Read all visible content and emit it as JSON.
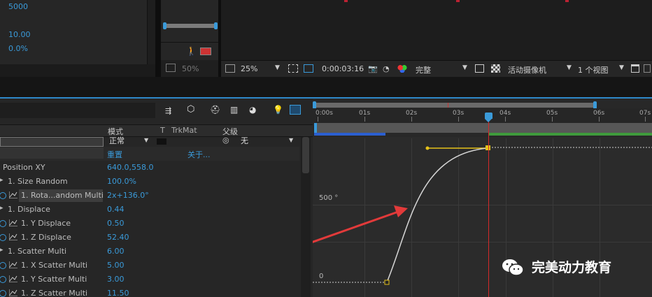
{
  "info_panel": {
    "value_5000": "5000",
    "value_10": "10.00",
    "value_0pct": "0.0%"
  },
  "mini_panel": {
    "zoom": "50%"
  },
  "comp_toolbar": {
    "zoom": "25%",
    "timecode": "0:00:03:16",
    "resolution": "完整",
    "camera": "活动摄像机",
    "views": "1 个视图"
  },
  "layer_columns": {
    "mode": "模式",
    "t": "T",
    "trkmat": "TrkMat",
    "parent": "父级"
  },
  "layer_row": {
    "mode_value": "正常",
    "parent_value": "无",
    "reset": "重置",
    "about": "关于..."
  },
  "properties": [
    {
      "label": "Position XY",
      "value": "640.0,558.0"
    },
    {
      "label": "1. Size Random",
      "value": "100.0%"
    },
    {
      "label": "1. Rota...andom Multi",
      "value": "2x+136.0°"
    },
    {
      "label": "1. Displace",
      "value": "0.44"
    },
    {
      "label": "1. Y Displace",
      "value": "0.50"
    },
    {
      "label": "1. Z Displace",
      "value": "52.40"
    },
    {
      "label": "1. Scatter Multi",
      "value": "6.00"
    },
    {
      "label": "1. X Scatter Multi",
      "value": "5.00"
    },
    {
      "label": "1. Y Scatter Multi",
      "value": "3.00"
    },
    {
      "label": "1. Z Scatter Multi",
      "value": "11.50"
    }
  ],
  "ruler": {
    "ticks": [
      "0:00s",
      "01s",
      "02s",
      "03s",
      "04s",
      "05s",
      "06s",
      "07s"
    ]
  },
  "graph": {
    "label_500": "500 °",
    "label_0": "0"
  },
  "watermark": {
    "text": "完美动力教育"
  },
  "colors": {
    "accent_blue": "#3a9ad9",
    "current_time_line": "#d42a2a",
    "keyframe_yellow": "#e6c21a",
    "arrow_red": "#e23a3a",
    "work_area_green": "#3f9a3c"
  }
}
